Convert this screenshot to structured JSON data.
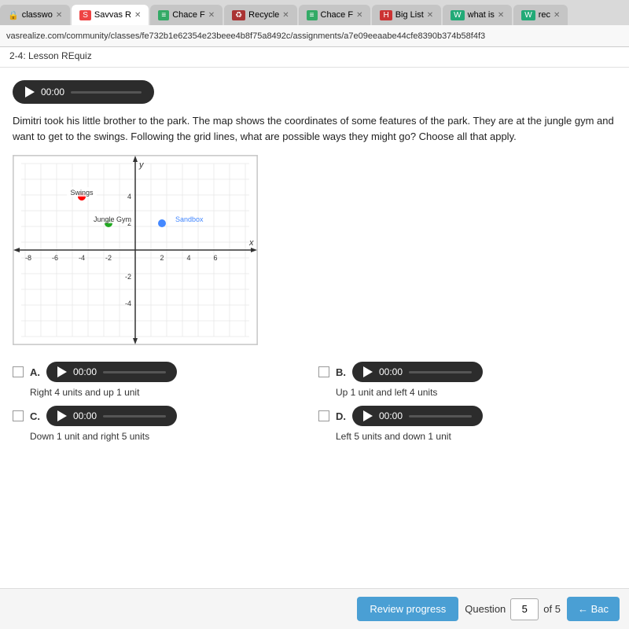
{
  "browser": {
    "tabs": [
      {
        "id": 1,
        "label": "classwo",
        "icon": "🔒",
        "active": false
      },
      {
        "id": 2,
        "label": "Savvas R",
        "icon": "S",
        "active": true
      },
      {
        "id": 3,
        "label": "Chace F",
        "icon": "≡",
        "active": false
      },
      {
        "id": 4,
        "label": "Recycle",
        "icon": "♻",
        "active": false
      },
      {
        "id": 5,
        "label": "Chace F",
        "icon": "≡",
        "active": false
      },
      {
        "id": 6,
        "label": "Big List",
        "icon": "H",
        "active": false
      },
      {
        "id": 7,
        "label": "what is",
        "icon": "W",
        "active": false
      },
      {
        "id": 8,
        "label": "rec",
        "icon": "W",
        "active": false
      }
    ],
    "url": "vasrealize.com/community/classes/fe732b1e62354e23beee4b8f75a8492c/assignments/a7e09eeaabe44cfe8390b374b58f4f3",
    "breadcrumb": "2-4: Lesson REquiz"
  },
  "audio_main": {
    "time": "00:00"
  },
  "question": {
    "text": "Dimitri took his little brother to the park. The map shows the coordinates of some features of the park. They are at the jungle gym and want to get to the swings. Following the grid lines, what are possible ways they might go? Choose all that apply."
  },
  "grid": {
    "points": [
      {
        "label": "Swings",
        "color": "red",
        "x": -4,
        "y": 4
      },
      {
        "label": "Jungle Gym",
        "color": "green",
        "x": -2,
        "y": 2
      },
      {
        "label": "Sandbox",
        "color": "#4488ff",
        "x": 2,
        "y": 2
      }
    ]
  },
  "answers": [
    {
      "id": "A",
      "time": "00:00",
      "desc": "Right 4 units and up 1 unit",
      "checked": false
    },
    {
      "id": "B",
      "time": "00:00",
      "desc": "Up 1 unit and left 4 units",
      "checked": false
    },
    {
      "id": "C",
      "time": "00:00",
      "desc": "Down 1 unit and right 5 units",
      "checked": false
    },
    {
      "id": "D",
      "time": "00:00",
      "desc": "Left 5 units and down 1 unit",
      "checked": false
    }
  ],
  "bottom": {
    "review_label": "Review progress",
    "question_label": "Question",
    "question_current": "5",
    "question_total": "of 5",
    "back_label": "← Bac"
  }
}
